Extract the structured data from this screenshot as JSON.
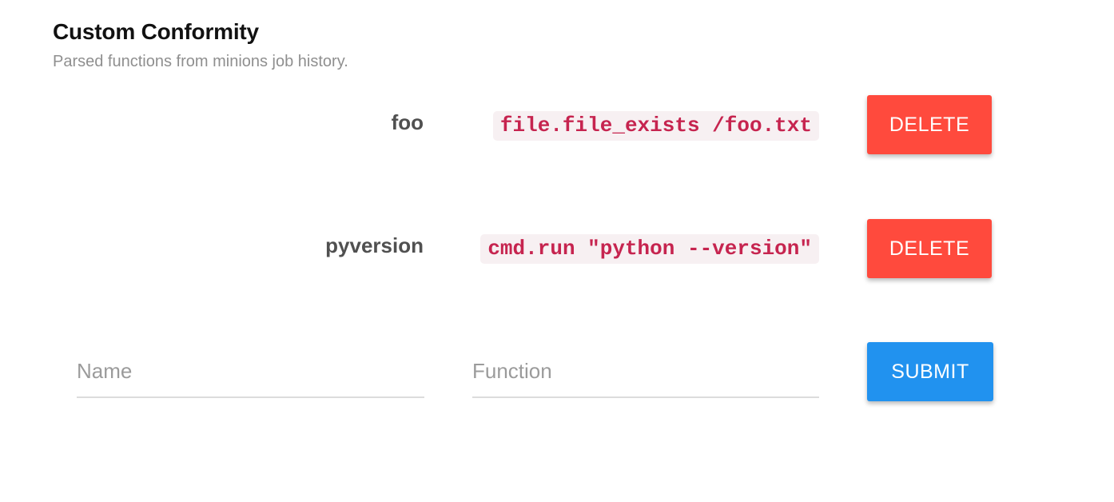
{
  "header": {
    "title": "Custom Conformity",
    "subtitle": "Parsed functions from minions job history."
  },
  "rows": [
    {
      "name": "foo",
      "function": "file.file_exists /foo.txt",
      "delete_label": "DELETE"
    },
    {
      "name": "pyversion",
      "function": "cmd.run \"python --version\"",
      "delete_label": "DELETE"
    }
  ],
  "form": {
    "name_placeholder": "Name",
    "name_value": "",
    "function_placeholder": "Function",
    "function_value": "",
    "submit_label": "SUBMIT"
  },
  "colors": {
    "delete": "#ff4a3d",
    "submit": "#2192ef",
    "code_text": "#c6244f",
    "code_bg": "#f7f0f2"
  }
}
